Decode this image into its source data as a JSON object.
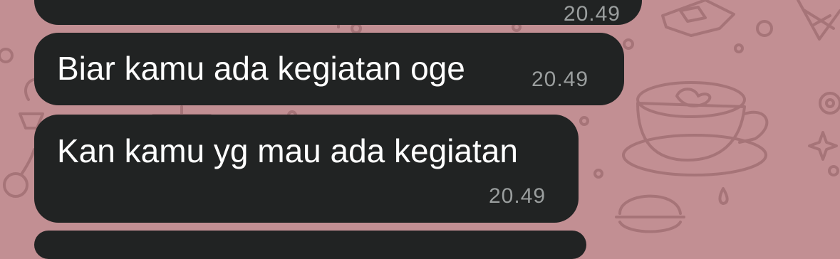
{
  "chat": {
    "messages": [
      {
        "text": "",
        "time": "20.49",
        "partial": "top"
      },
      {
        "text": "Biar kamu ada kegiatan oge",
        "time": "20.49"
      },
      {
        "text": "Kan kamu yg mau ada kegiatan",
        "time": "20.49"
      },
      {
        "text": "",
        "time": "",
        "partial": "bottom"
      }
    ]
  },
  "colors": {
    "wallpaper": "#c28f93",
    "bubble": "#212323",
    "message_text": "#ffffff",
    "timestamp_text": "#9a9e9e",
    "doodle_stroke": "#a67478"
  },
  "wallpaper": {
    "doodles": [
      "chocolate-bar-icon",
      "ice-cream-cone-icon",
      "coffee-cup-icon",
      "macaron-icon",
      "sparkle-icon",
      "flower-icon",
      "cherry-icon",
      "cupcake-icon"
    ]
  }
}
